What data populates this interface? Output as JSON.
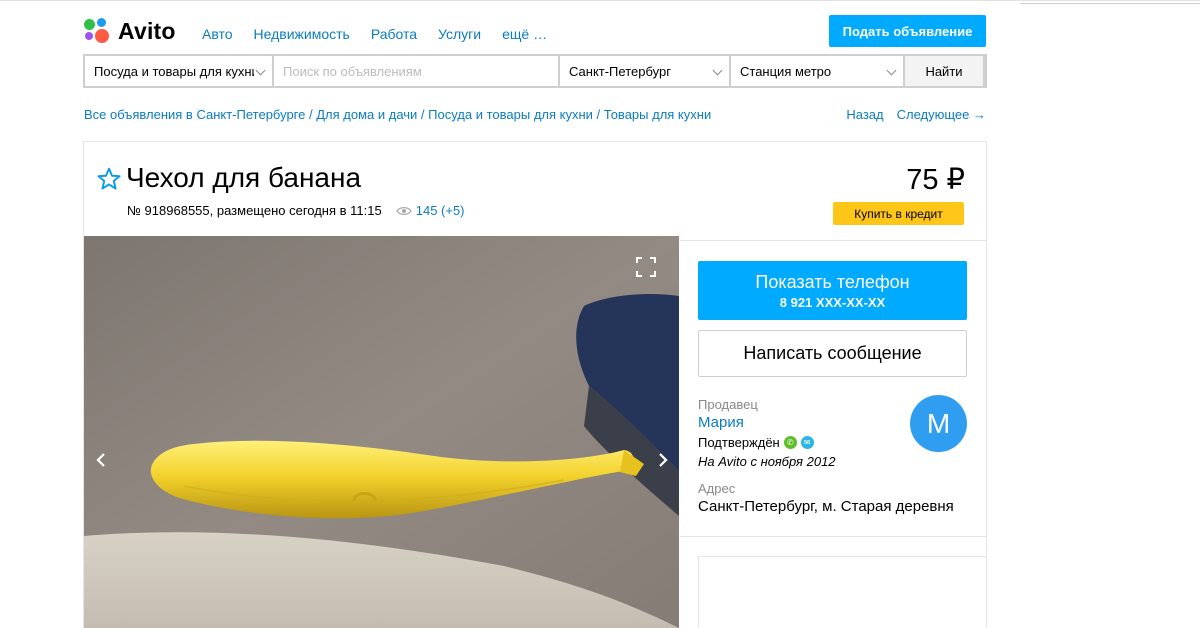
{
  "brand": {
    "name": "Avito"
  },
  "nav": {
    "items": [
      "Авто",
      "Недвижимость",
      "Работа",
      "Услуги",
      "ещё …"
    ]
  },
  "header": {
    "post_button": "Подать объявление"
  },
  "search": {
    "category": "Посуда и товары для кухни",
    "placeholder": "Поиск по объявлениям",
    "city": "Санкт-Петербург",
    "metro": "Станция метро",
    "find_button": "Найти"
  },
  "breadcrumbs": {
    "items": [
      "Все объявления в Санкт-Петербурге",
      "Для дома и дачи",
      "Посуда и товары для кухни",
      "Товары для кухни"
    ],
    "separator": "/",
    "back": "Назад",
    "next": "Следующее →"
  },
  "listing": {
    "title": "Чехол для банана",
    "number": "№ 918968555, размещено сегодня в 11:15",
    "views": "145 (+5)",
    "price": "75 ₽",
    "credit_button": "Купить в кредит"
  },
  "contact": {
    "show_phone": "Показать телефон",
    "phone_masked": "8 921 XXX-XX-XX",
    "write_message": "Написать сообщение"
  },
  "seller": {
    "label": "Продавец",
    "name": "Мария",
    "verified": "Подтверждён",
    "since": "На Avito с ноября 2012",
    "avatar_letter": "M",
    "address_label": "Адрес",
    "address": "Санкт-Петербург, м. Старая деревня"
  },
  "colors": {
    "accent": "#00aaff",
    "link": "#0a7cc1",
    "credit": "#ffc61a",
    "avatar": "#2f9ef0"
  }
}
